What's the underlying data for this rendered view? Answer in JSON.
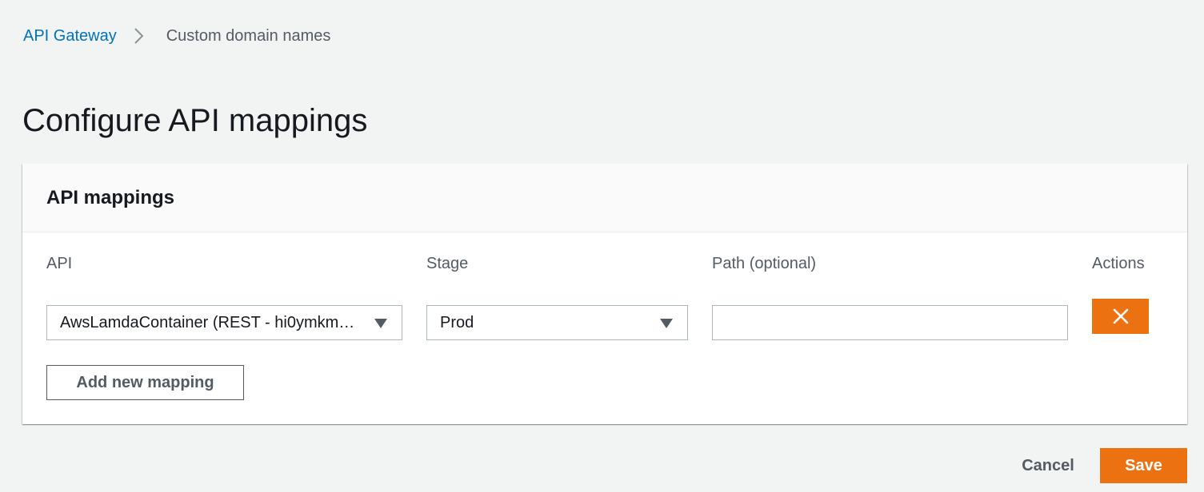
{
  "breadcrumb": {
    "root": "API Gateway",
    "current": "Custom domain names"
  },
  "page": {
    "title": "Configure API mappings"
  },
  "mappings_panel": {
    "title": "API mappings",
    "columns": {
      "api": "API",
      "stage": "Stage",
      "path": "Path (optional)",
      "actions": "Actions"
    },
    "rows": [
      {
        "api_value": "AwsLamdaContainer (REST - hi0ymkm…",
        "stage_value": "Prod",
        "path_value": ""
      }
    ],
    "add_button": "Add new mapping"
  },
  "footer": {
    "cancel_label": "Cancel",
    "save_label": "Save"
  },
  "colors": {
    "primary_orange": "#ec7211",
    "link_blue": "#0073bb",
    "background": "#f2f3f3"
  }
}
